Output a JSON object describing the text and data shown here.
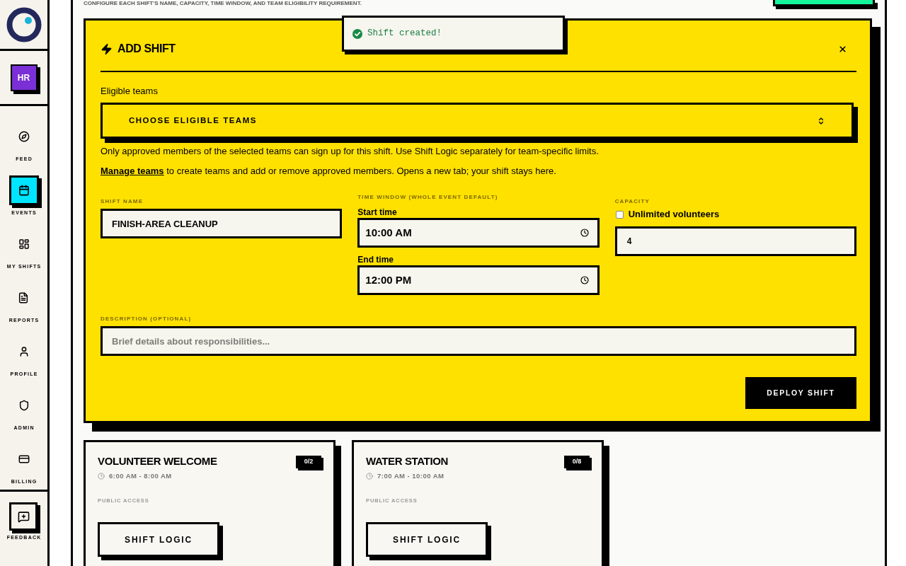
{
  "sidebar": {
    "avatar": "HR",
    "nav": [
      {
        "label": "FEED",
        "selected": false
      },
      {
        "label": "EVENTS",
        "selected": true
      },
      {
        "label": "MY SHIFTS",
        "selected": false
      },
      {
        "label": "REPORTS",
        "selected": false
      },
      {
        "label": "PROFILE",
        "selected": false
      },
      {
        "label": "ADMIN",
        "selected": false
      },
      {
        "label": "BILLING",
        "selected": false
      }
    ],
    "feedback": "FEEDBACK"
  },
  "header": {
    "subtitle": "CONFIGURE EACH SHIFT'S NAME, CAPACITY, TIME WINDOW, AND TEAM ELIGIBILITY REQUIREMENT."
  },
  "toast": {
    "message": "Shift created!"
  },
  "modal": {
    "title": "ADD SHIFT",
    "eligible_teams": {
      "label": "Eligible teams",
      "prompt": "CHOOSE ELIGIBLE TEAMS",
      "help": "Only approved members of the selected teams can sign up for this shift. Use Shift Logic separately for team-specific limits.",
      "manage_link": "Manage teams",
      "manage_text": "to create teams and add or remove approved members. Opens a new tab; your shift stays here."
    },
    "shift_name": {
      "label": "SHIFT NAME",
      "value": "FINISH-AREA CLEANUP"
    },
    "time_window": {
      "label": "TIME WINDOW (WHOLE EVENT DEFAULT)",
      "start": {
        "label": "Start time",
        "value": "10:00 AM"
      },
      "end": {
        "label": "End time",
        "value": "12:00 PM"
      }
    },
    "capacity": {
      "label": "CAPACITY",
      "unlimited": {
        "label": "Unlimited volunteers",
        "checked": false
      },
      "value": "4"
    },
    "description": {
      "label": "DESCRIPTION (OPTIONAL)",
      "placeholder": "Brief details about responsibilities..."
    },
    "submit": "DEPLOY SHIFT"
  },
  "shifts": [
    {
      "title": "VOLUNTEER WELCOME",
      "filled": "0/2",
      "time": "6:00 AM - 8:00 AM",
      "access": "PUBLIC ACCESS",
      "action": "SHIFT LOGIC"
    },
    {
      "title": "WATER STATION",
      "filled": "0/8",
      "time": "7:00 AM - 10:00 AM",
      "access": "PUBLIC ACCESS",
      "action": "SHIFT LOGIC"
    }
  ]
}
